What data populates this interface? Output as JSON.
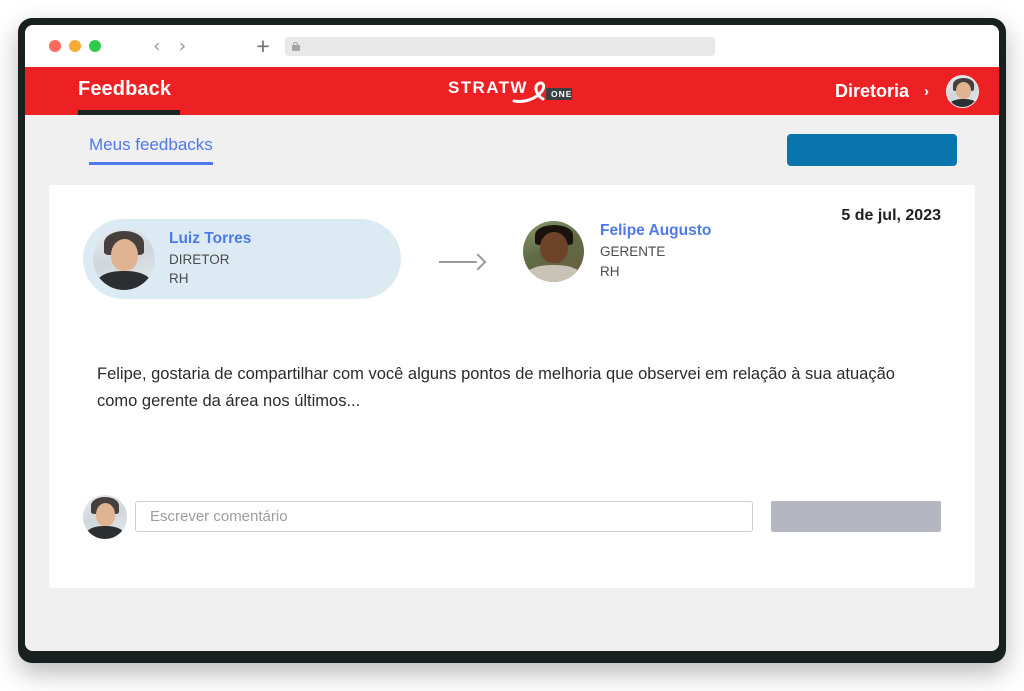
{
  "browser": {
    "traffic_lights": [
      "close",
      "minimize",
      "maximize"
    ],
    "back_label": "‹",
    "forward_label": "›",
    "new_tab_label": "+",
    "url_value": "",
    "url_placeholder": ""
  },
  "header": {
    "title": "Feedback",
    "logo_text": "STRATW",
    "logo_badge": "ONE",
    "org_name": "Diretoria",
    "org_chevron": "›"
  },
  "toolbar": {
    "tab_label": "Meus feedbacks",
    "primary_button_label": ""
  },
  "feedback": {
    "date": "5 de jul, 2023",
    "sender": {
      "name": "Luiz Torres",
      "role": "DIRETOR",
      "dept": "RH"
    },
    "receiver": {
      "name": "Felipe Augusto",
      "role": "GERENTE",
      "dept": "RH"
    },
    "body": "Felipe, gostaria de compartilhar com você alguns pontos de melhoria que observei em relação à sua atuação como gerente da área nos últimos...",
    "comment_placeholder": "Escrever comentário",
    "comment_value": "",
    "send_button_label": ""
  },
  "colors": {
    "brand_red": "#ed2024",
    "link_blue": "#4f79e8",
    "primary_blue": "#0a74ad",
    "sender_pill": "#dcebf3",
    "send_gray": "#b4b7c2"
  }
}
